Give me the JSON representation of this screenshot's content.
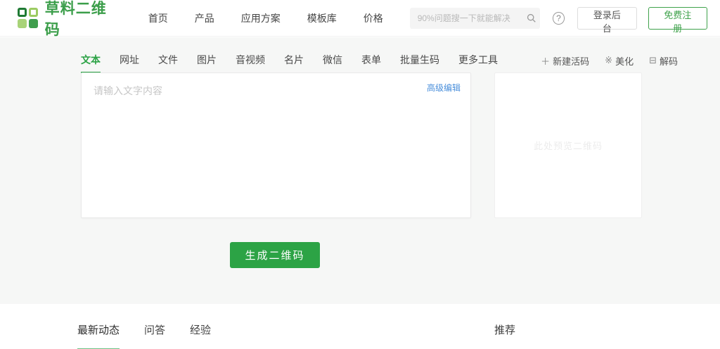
{
  "header": {
    "logo_text": "草料二维码",
    "nav": [
      {
        "label": "首页"
      },
      {
        "label": "产品"
      },
      {
        "label": "应用方案"
      },
      {
        "label": "模板库"
      },
      {
        "label": "价格"
      }
    ],
    "search": {
      "placeholder": "90%问题搜一下就能解决"
    },
    "help_icon": "?",
    "login_button": "登录后台",
    "register_button": "免费注册"
  },
  "generator": {
    "tabs": [
      {
        "label": "文本",
        "active": true
      },
      {
        "label": "网址"
      },
      {
        "label": "文件"
      },
      {
        "label": "图片"
      },
      {
        "label": "音视频"
      },
      {
        "label": "名片"
      },
      {
        "label": "微信"
      },
      {
        "label": "表单"
      },
      {
        "label": "批量生码"
      },
      {
        "label": "更多工具"
      }
    ],
    "quick_links": [
      {
        "label": "新建活码",
        "icon_glyph": "＋"
      },
      {
        "label": "美化",
        "icon_glyph": "※"
      },
      {
        "label": "解码",
        "icon_glyph": "⊟"
      }
    ],
    "input": {
      "value": "",
      "placeholder": "请输入文字内容",
      "advanced_edit_label": "高级编辑"
    },
    "preview": {
      "placeholder": "此处预览二维码"
    },
    "generate_button": "生成二维码"
  },
  "bottom": {
    "tabs": [
      {
        "label": "最新动态",
        "active": true
      },
      {
        "label": "问答"
      },
      {
        "label": "经验"
      }
    ],
    "recommend_label": "推荐"
  },
  "colors": {
    "brand_green": "#3b9e4a",
    "tab_active_green": "#2ba245",
    "button_green": "#2ca345",
    "link_blue": "#4a8fdb",
    "page_gray": "#f6f7f6"
  }
}
